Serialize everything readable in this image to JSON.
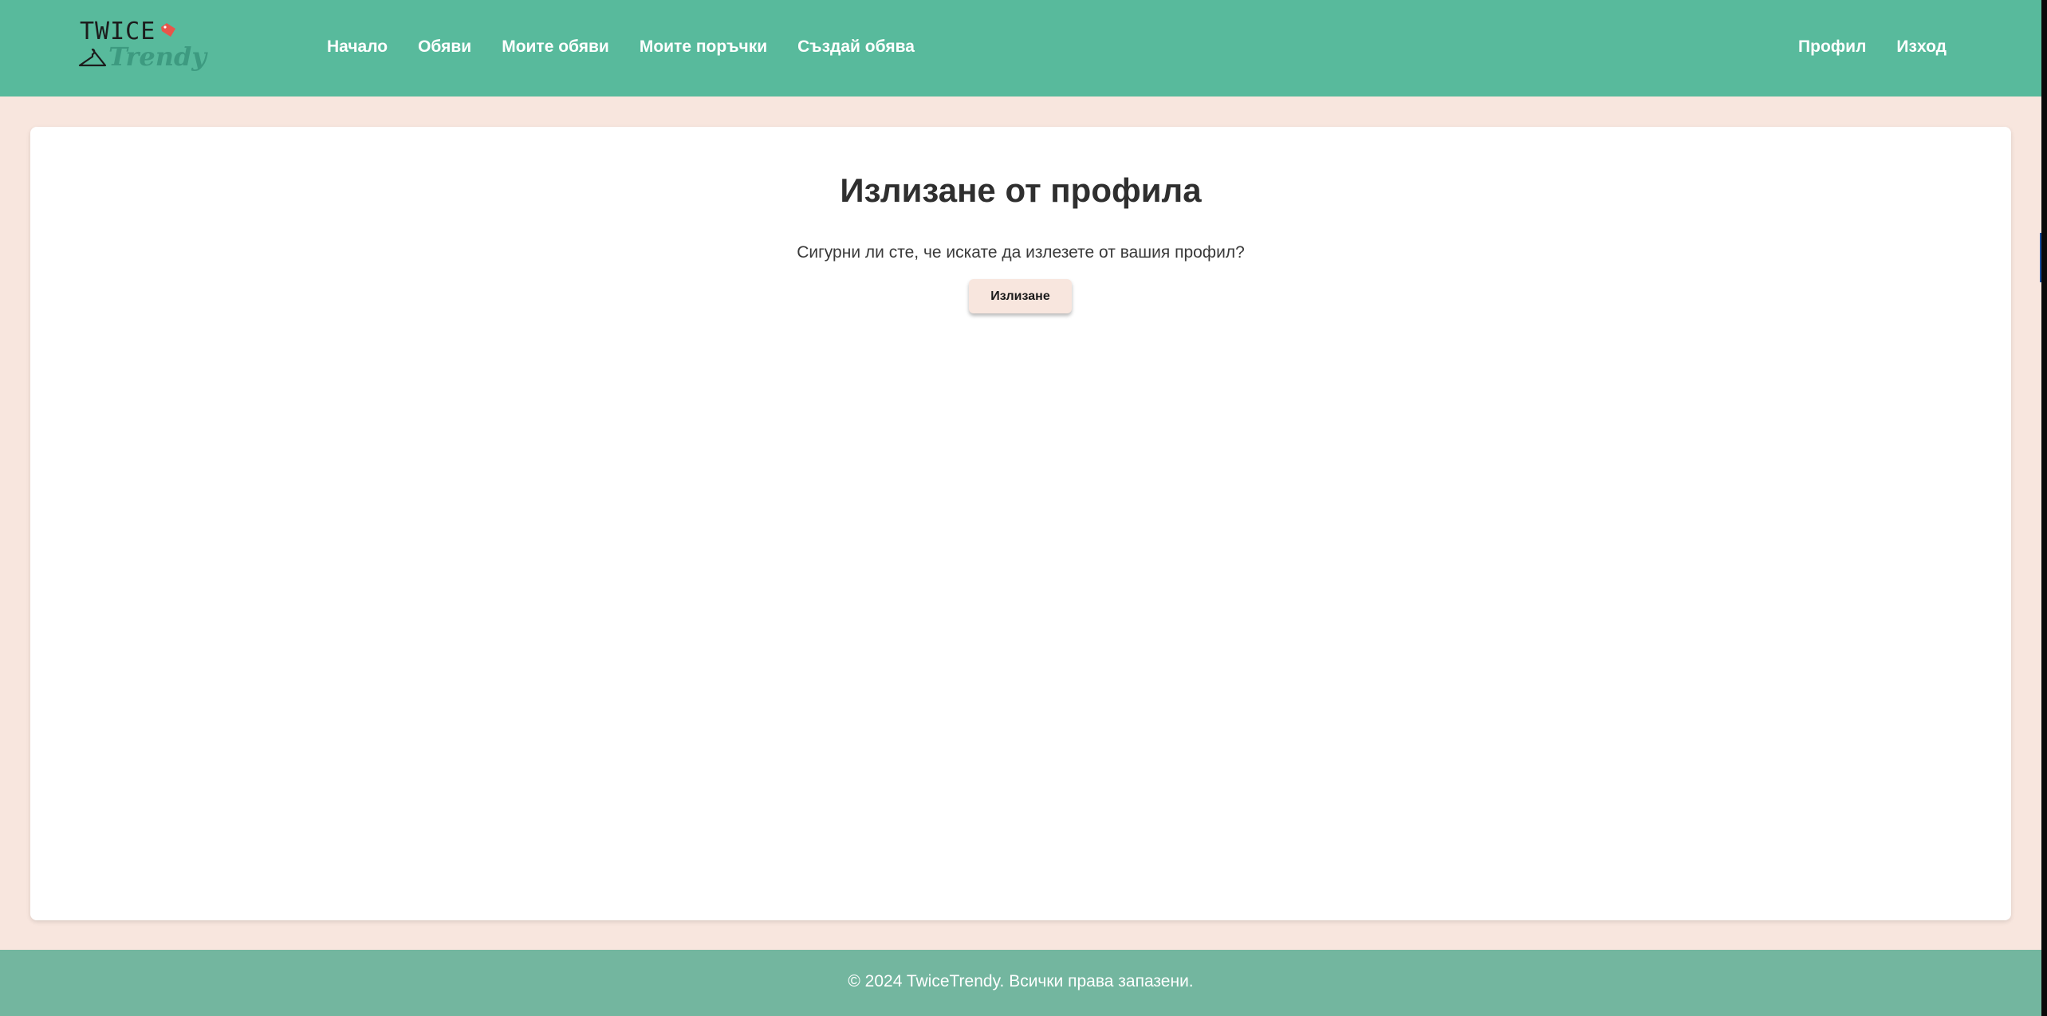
{
  "brand": {
    "logo_top": "TWICE",
    "logo_bottom": "Trendy",
    "tag_color": "#e8554a",
    "accent_color": "#58ba9c"
  },
  "nav": {
    "left": [
      {
        "label": "Начало"
      },
      {
        "label": "Обяви"
      },
      {
        "label": "Моите обяви"
      },
      {
        "label": "Моите поръчки"
      },
      {
        "label": "Създай обява"
      }
    ],
    "right": [
      {
        "label": "Профил"
      },
      {
        "label": "Изход"
      }
    ]
  },
  "main": {
    "title": "Излизане от профила",
    "message": "Сигурни ли сте, че искате да излезете от вашия профил?",
    "logout_button": "Излизане"
  },
  "footer": {
    "text": "© 2024 TwiceTrendy. Всички права запазени."
  },
  "icons": {
    "tag": "price-tag-icon",
    "hanger": "hanger-icon"
  }
}
